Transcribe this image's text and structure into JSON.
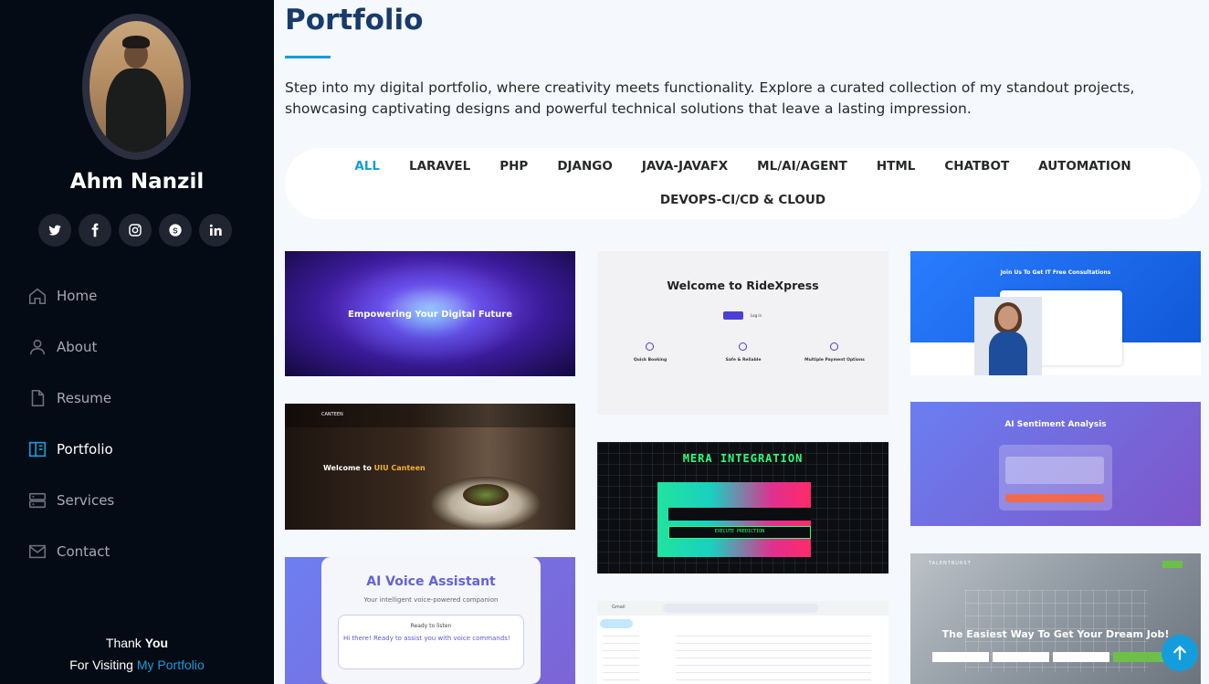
{
  "profile": {
    "name": "Ahm Nanzil"
  },
  "socials": [
    {
      "icon": "twitter-icon"
    },
    {
      "icon": "facebook-icon"
    },
    {
      "icon": "instagram-icon"
    },
    {
      "icon": "skype-icon"
    },
    {
      "icon": "linkedin-icon"
    }
  ],
  "nav": {
    "items": [
      {
        "label": "Home",
        "icon": "home-icon",
        "active": false
      },
      {
        "label": "About",
        "icon": "person-icon",
        "active": false
      },
      {
        "label": "Resume",
        "icon": "document-icon",
        "active": false
      },
      {
        "label": "Portfolio",
        "icon": "book-icon",
        "active": true
      },
      {
        "label": "Services",
        "icon": "server-icon",
        "active": false
      },
      {
        "label": "Contact",
        "icon": "envelope-icon",
        "active": false
      }
    ]
  },
  "footer": {
    "thank": "Thank",
    "you": "You",
    "visiting": "For Visiting",
    "link": "My Portfolio"
  },
  "main": {
    "title": "Portfolio",
    "intro": "Step into my digital portfolio, where creativity meets functionality. Explore a curated collection of my standout projects, showcasing captivating designs and powerful technical solutions that leave a lasting impression."
  },
  "filters": {
    "row1": [
      "ALL",
      "LARAVEL",
      "PHP",
      "DJANGO",
      "JAVA-JAVAFX",
      "ML/AI/AGENT",
      "HTML",
      "CHATBOT",
      "AUTOMATION"
    ],
    "row2": [
      "DEVOPS-CI/CD & CLOUD"
    ],
    "active": "ALL"
  },
  "cards": {
    "digital": {
      "title": "Empowering Your Digital Future"
    },
    "canteen": {
      "prefix": "Welcome to",
      "highlight": "UIU Canteen",
      "logo": "CANTEEN"
    },
    "voice": {
      "title": "AI Voice Assistant",
      "subtitle": "Your intelligent voice-powered companion",
      "status": "Ready to listen",
      "message": "Hi there! Ready to assist you with voice commands!"
    },
    "ride": {
      "title": "Welcome to RideXpress",
      "login": "Log in",
      "feature1": "Quick Booking",
      "feature2": "Safe & Reliable",
      "feature3": "Multiple Payment Options"
    },
    "mera": {
      "title": "MERA INTEGRATION",
      "button": "EXECUTE PREDICTION"
    },
    "gmail": {
      "logo": "Gmail"
    },
    "consult": {
      "title": "Join Us To Get IT Free Consultations"
    },
    "sentiment": {
      "title": "AI Sentiment Analysis"
    },
    "talent": {
      "title": "The Easiest Way To Get Your Dream Job!",
      "logo": "TALENTBURST"
    }
  },
  "colors": {
    "accent": "#149ddd",
    "sidebar": "#040b14",
    "title": "#173b6c",
    "background": "#f5f8fd"
  }
}
